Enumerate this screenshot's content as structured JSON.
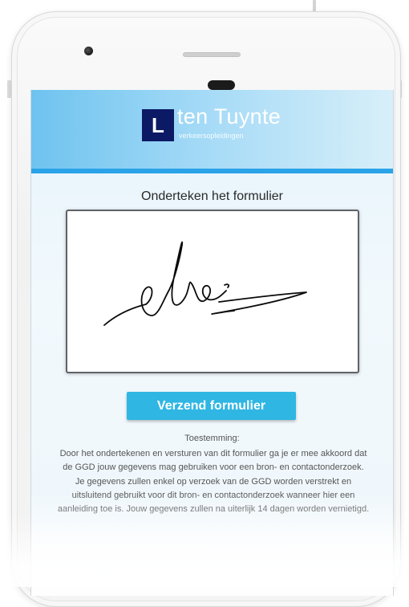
{
  "logo": {
    "letter": "L",
    "name": "ten Tuynte",
    "subtitle": "verkeersopleidingen",
    "box_color": "#0c1a66"
  },
  "form": {
    "title": "Onderteken het formulier",
    "submit_label": "Verzend formulier",
    "accent_color": "#2fb6e3"
  },
  "consent": {
    "title": "Toestemming:",
    "text": "Door het ondertekenen en versturen van dit formulier ga je er mee akkoord dat de GGD jouw gegevens mag gebruiken voor een bron- en contactonderzoek. Je gegevens zullen enkel op verzoek van de GGD worden verstrekt en uitsluitend gebruikt voor dit bron- en contactonderzoek wanneer hier een aanleiding toe is. Jouw gegevens zullen na uiterlijk 14 dagen worden vernietigd."
  },
  "icons": {
    "camera": "camera-icon",
    "speaker": "speaker-icon"
  }
}
